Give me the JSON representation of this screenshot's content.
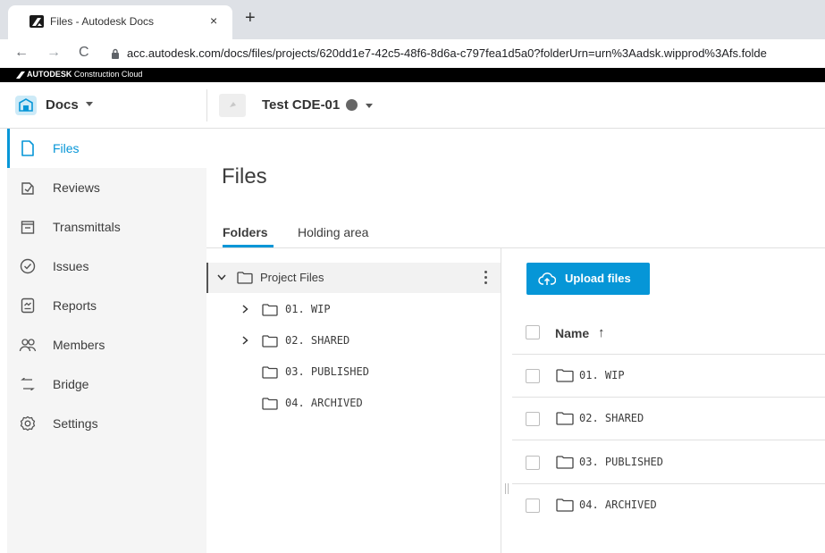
{
  "browser": {
    "tab_title": "Files - Autodesk Docs",
    "close_glyph": "×",
    "new_tab_glyph": "+",
    "back_glyph": "←",
    "forward_glyph": "→",
    "reload_glyph": "C",
    "url": "acc.autodesk.com/docs/files/projects/620dd1e7-42c5-48f6-8d6a-c797fea1d5a0?folderUrn=urn%3Aadsk.wipprod%3Afs.folde"
  },
  "brand": {
    "name": "AUTODESK",
    "product": "Construction Cloud"
  },
  "header": {
    "module": "Docs",
    "project": "Test CDE-01"
  },
  "sidebar": {
    "items": [
      {
        "label": "Files",
        "icon": "file-icon",
        "active": true
      },
      {
        "label": "Reviews",
        "icon": "reviews-icon"
      },
      {
        "label": "Transmittals",
        "icon": "transmittals-icon"
      },
      {
        "label": "Issues",
        "icon": "issues-icon"
      },
      {
        "label": "Reports",
        "icon": "reports-icon"
      },
      {
        "label": "Members",
        "icon": "members-icon"
      },
      {
        "label": "Bridge",
        "icon": "bridge-icon"
      },
      {
        "label": "Settings",
        "icon": "settings-icon"
      }
    ]
  },
  "main": {
    "title": "Files",
    "tabs": [
      {
        "label": "Folders",
        "active": true
      },
      {
        "label": "Holding area"
      }
    ]
  },
  "tree": {
    "root": "Project Files",
    "children": [
      "01. WIP",
      "02. SHARED",
      "03. PUBLISHED",
      "04. ARCHIVED"
    ]
  },
  "table": {
    "upload_label": "Upload files",
    "column_name": "Name",
    "sort_glyph": "↑",
    "rows": [
      "01. WIP",
      "02. SHARED",
      "03. PUBLISHED",
      "04. ARCHIVED"
    ]
  },
  "colors": {
    "accent": "#0696d7",
    "sidebar_bg": "#f5f5f5",
    "brand_bar": "#000000"
  }
}
